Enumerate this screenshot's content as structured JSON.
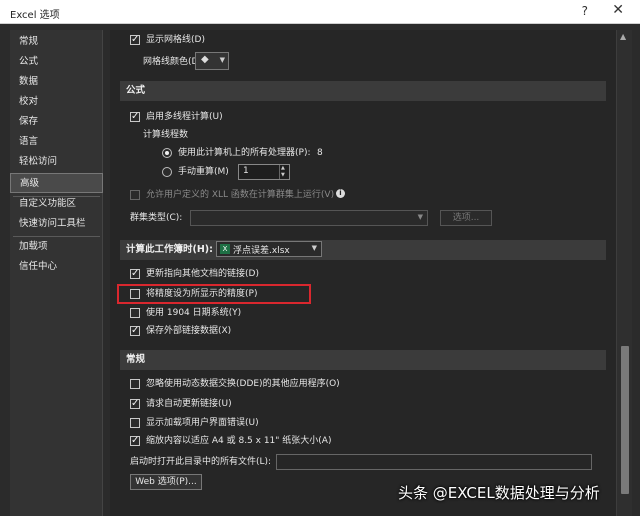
{
  "window": {
    "title": "Excel 选项",
    "help": "?",
    "close": "✕"
  },
  "nav": {
    "items": [
      {
        "label": "常规"
      },
      {
        "label": "公式"
      },
      {
        "label": "数据"
      },
      {
        "label": "校对"
      },
      {
        "label": "保存"
      },
      {
        "label": "语言"
      },
      {
        "label": "轻松访问"
      },
      {
        "label": "高级",
        "selected": true
      },
      {
        "label": "自定义功能区"
      },
      {
        "label": "快速访问工具栏"
      },
      {
        "label": "加载项"
      },
      {
        "label": "信任中心"
      }
    ]
  },
  "grid": {
    "show_gridlines": "显示网格线(D)",
    "gridline_color_label": "网格线颜色(D)",
    "bucket_icon": "paint-bucket-icon"
  },
  "formulas": {
    "heading": "公式",
    "multithread": "启用多线程计算(U)",
    "threads_label": "计算线程数",
    "use_all": "使用此计算机上的所有处理器(P):",
    "processor_count": "8",
    "manual": "手动重算(M)",
    "manual_value": "1",
    "xll": "允许用户定义的 XLL 函数在计算群集上运行(V)",
    "cluster_type": "群集类型(C):",
    "options_btn": "选项..."
  },
  "workbook": {
    "heading": "计算此工作簿时(H):",
    "file": "浮点误差.xlsx",
    "file_icon": "X",
    "update_links": "更新指向其他文档的链接(D)",
    "precision": "将精度设为所显示的精度(P)",
    "date1904": "使用 1904 日期系统(Y)",
    "save_external": "保存外部链接数据(X)"
  },
  "general": {
    "heading": "常规",
    "ignore_dde": "忽略使用动态数据交换(DDE)的其他应用程序(O)",
    "auto_update": "请求自动更新链接(U)",
    "addin_errors": "显示加载项用户界面错误(U)",
    "scale_a4": "缩放内容以适应 A4 或 8.5 x 11\" 纸张大小(A)",
    "startup_open": "启动时打开此目录中的所有文件(L):",
    "web_options": "Web 选项(P)..."
  },
  "watermark": "头条 @EXCEL数据处理与分析",
  "colors": {
    "highlight": "#d9272e",
    "excel_green": "#1e7145",
    "background": "#2b2b2b"
  }
}
